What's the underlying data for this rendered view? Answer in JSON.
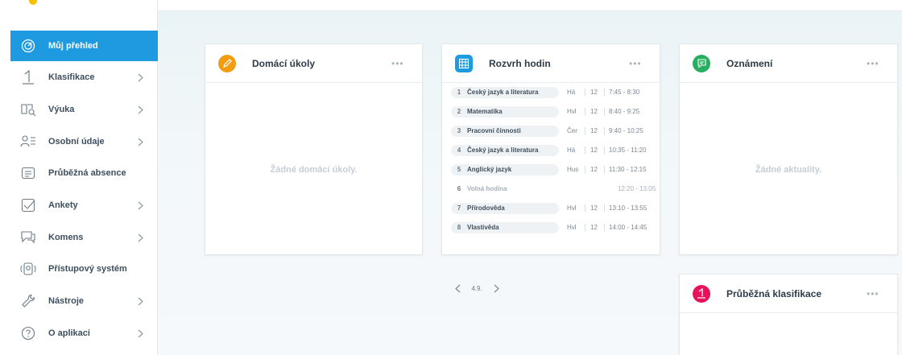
{
  "sidebar": {
    "items": [
      {
        "label": "Můj přehled",
        "icon": "target-icon",
        "active": true,
        "chevron": false
      },
      {
        "label": "Klasifikace",
        "icon": "grade-one-icon",
        "chevron": true
      },
      {
        "label": "Výuka",
        "icon": "book-search-icon",
        "chevron": true
      },
      {
        "label": "Osobní údaje",
        "icon": "person-list-icon",
        "chevron": true
      },
      {
        "label": "Průběžná absence",
        "icon": "list-card-icon",
        "chevron": false
      },
      {
        "label": "Ankety",
        "icon": "checkbox-icon",
        "chevron": true
      },
      {
        "label": "Komens",
        "icon": "chat-bubbles-icon",
        "chevron": true
      },
      {
        "label": "Přístupový systém",
        "icon": "access-card-icon",
        "chevron": false
      },
      {
        "label": "Nástroje",
        "icon": "wrench-icon",
        "chevron": true
      },
      {
        "label": "O aplikaci",
        "icon": "question-icon",
        "chevron": true
      }
    ]
  },
  "cards": {
    "homework": {
      "title": "Domácí úkoly",
      "empty": "Žádné domácí úkoly.",
      "more": "•••"
    },
    "schedule": {
      "title": "Rozvrh hodin",
      "more": "•••",
      "rows": [
        {
          "num": "1",
          "subject": "Český jazyk a literatura",
          "teacher": "Há",
          "room": "12",
          "time": "7:45 - 8:30"
        },
        {
          "num": "2",
          "subject": "Matematika",
          "teacher": "Hvl",
          "room": "12",
          "time": "8:40 - 9:25"
        },
        {
          "num": "3",
          "subject": "Pracovní činnosti",
          "teacher": "Čer",
          "room": "12",
          "time": "9:40 - 10:25"
        },
        {
          "num": "4",
          "subject": "Český jazyk a literatura",
          "teacher": "Há",
          "room": "12",
          "time": "10:35 - 11:20"
        },
        {
          "num": "5",
          "subject": "Anglický jazyk",
          "teacher": "Hus",
          "room": "12",
          "time": "11:30 - 12:15"
        },
        {
          "num": "6",
          "subject": "Volná hodina",
          "teacher": "",
          "room": "",
          "time": "12:20 - 13:05",
          "free": true
        },
        {
          "num": "7",
          "subject": "Přírodověda",
          "teacher": "Hvl",
          "room": "12",
          "time": "13:10 - 13:55"
        },
        {
          "num": "8",
          "subject": "Vlastivěda",
          "teacher": "Hvl",
          "room": "12",
          "time": "14:00 - 14:45"
        }
      ],
      "date": "4.9.",
      "prev": "‹",
      "next": "›"
    },
    "announcements": {
      "title": "Oznámení",
      "empty": "Žádné aktuality.",
      "more": "•••"
    },
    "grades": {
      "title": "Průběžná klasifikace",
      "more": "•••"
    }
  },
  "colors": {
    "accent": "#1e9be0",
    "homework": "#f39c12",
    "schedule": "#1e9be0",
    "announcements": "#27ae60",
    "grades": "#e6135c"
  }
}
